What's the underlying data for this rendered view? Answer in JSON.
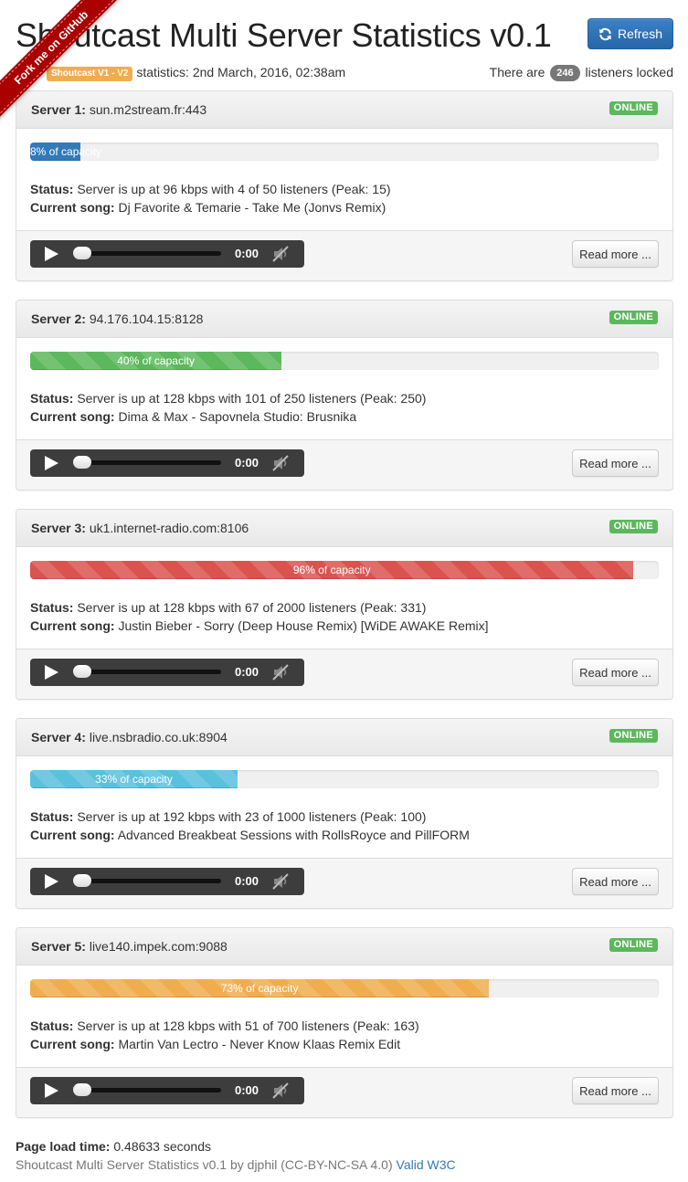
{
  "header": {
    "title": "Shoutcast Multi Server Statistics v0.1",
    "refresh_label": "Refresh",
    "version_badge_v1": "Shoutcast V1",
    "version_badge_sep": " - ",
    "version_badge_v2": "V2",
    "statistics_text": "statistics: 2nd March, 2016, 02:38am",
    "listeners_prefix": "There are",
    "listeners_count": "246",
    "listeners_suffix": "listeners locked"
  },
  "ribbon": {
    "label": "Fork me on GitHub"
  },
  "colors": {
    "primary": "#337ab7",
    "success": "#5cb85c",
    "info": "#5bc0de",
    "danger": "#d9534f",
    "warning": "#f0ad4e",
    "ribbon": "#aa0000"
  },
  "servers": [
    {
      "label": "Server 1:",
      "address": "sun.m2stream.fr:443",
      "online_label": "ONLINE",
      "capacity": 8,
      "capacity_text": "8% of capacity",
      "bar_color": "#337ab7",
      "striped": false,
      "status_label": "Status:",
      "status_text": "Server is up at 96 kbps with 4 of 50 listeners (Peak: 15)",
      "song_label": "Current song:",
      "song_text": "Dj Favorite & Temarie - Take Me (Jonvs Remix)",
      "time": "0:00",
      "readmore_label": "Read more ..."
    },
    {
      "label": "Server 2:",
      "address": "94.176.104.15:8128",
      "online_label": "ONLINE",
      "capacity": 40,
      "capacity_text": "40% of capacity",
      "bar_color": "#5cb85c",
      "striped": true,
      "status_label": "Status:",
      "status_text": "Server is up at 128 kbps with 101 of 250 listeners (Peak: 250)",
      "song_label": "Current song:",
      "song_text": "Dima & Max - Sapovnela Studio: Brusnika",
      "time": "0:00",
      "readmore_label": "Read more ..."
    },
    {
      "label": "Server 3:",
      "address": "uk1.internet-radio.com:8106",
      "online_label": "ONLINE",
      "capacity": 96,
      "capacity_text": "96% of capacity",
      "bar_color": "#d9534f",
      "striped": true,
      "status_label": "Status:",
      "status_text": "Server is up at 128 kbps with 67 of 2000 listeners (Peak: 331)",
      "song_label": "Current song:",
      "song_text": "Justin Bieber - Sorry (Deep House Remix) [WiDE AWAKE Remix]",
      "time": "0:00",
      "readmore_label": "Read more ..."
    },
    {
      "label": "Server 4:",
      "address": "live.nsbradio.co.uk:8904",
      "online_label": "ONLINE",
      "capacity": 33,
      "capacity_text": "33% of capacity",
      "bar_color": "#5bc0de",
      "striped": true,
      "status_label": "Status:",
      "status_text": "Server is up at 192 kbps with 23 of 1000 listeners (Peak: 100)",
      "song_label": "Current song:",
      "song_text": "Advanced Breakbeat Sessions with RollsRoyce and PillFORM",
      "time": "0:00",
      "readmore_label": "Read more ..."
    },
    {
      "label": "Server 5:",
      "address": "live140.impek.com:9088",
      "online_label": "ONLINE",
      "capacity": 73,
      "capacity_text": "73% of capacity",
      "bar_color": "#f0ad4e",
      "striped": true,
      "status_label": "Status:",
      "status_text": "Server is up at 128 kbps with 51 of 700 listeners (Peak: 163)",
      "song_label": "Current song:",
      "song_text": "Martin Van Lectro - Never Know Klaas Remix Edit",
      "time": "0:00",
      "readmore_label": "Read more ..."
    }
  ],
  "footer": {
    "load_label": "Page load time:",
    "load_value": "0.48633 seconds",
    "credits": "Shoutcast Multi Server Statistics v0.1 by djphil (CC-BY-NC-SA 4.0)",
    "w3c_link": "Valid W3C"
  },
  "icons": {
    "refresh": "refresh-icon",
    "play": "play-icon",
    "mute": "volume-mute-icon"
  }
}
